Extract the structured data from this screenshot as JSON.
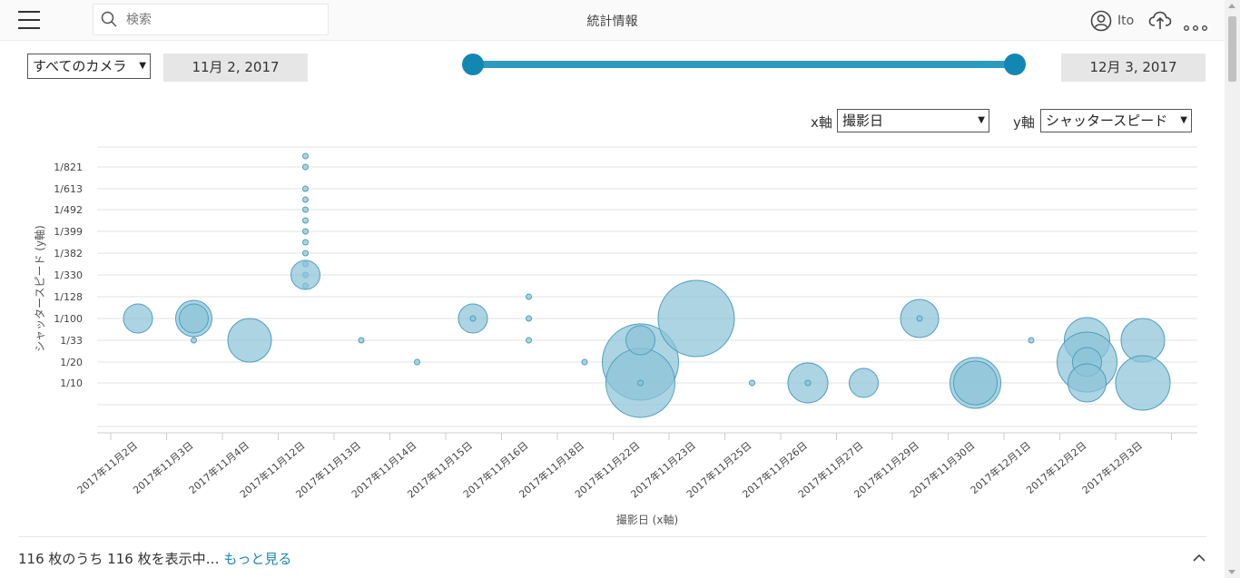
{
  "header": {
    "title": "統計情報",
    "search_placeholder": "検索",
    "user_name": "Ito"
  },
  "filters": {
    "camera": "すべてのカメラ",
    "start_date": "11月 2, 2017",
    "end_date": "12月 3, 2017",
    "x_axis_label": "x軸",
    "x_axis_value": "撮影日",
    "y_axis_label": "y軸",
    "y_axis_value": "シャッタースピード"
  },
  "footer": {
    "count_text": "116 枚のうち 116 枚を表示中… ",
    "more_link": "もっと見る"
  },
  "colors": {
    "accent": "#1287b3",
    "track": "#2d9bbd",
    "bubble_fill": "#8cc3d8",
    "bubble_stroke": "#4d9fbe"
  },
  "chart_data": {
    "type": "scatter",
    "xlabel": "撮影日 (x軸)",
    "ylabel": "シャッタースピード (y軸)",
    "categories": [
      "2017年11月2日",
      "2017年11月3日",
      "2017年11月4日",
      "2017年11月12日",
      "2017年11月13日",
      "2017年11月14日",
      "2017年11月15日",
      "2017年11月16日",
      "2017年11月18日",
      "2017年11月22日",
      "2017年11月23日",
      "2017年11月25日",
      "2017年11月26日",
      "2017年11月27日",
      "2017年11月29日",
      "2017年11月30日",
      "2017年12月1日",
      "2017年12月2日",
      "2017年12月3日"
    ],
    "y_ticks": [
      "1/10",
      "1/20",
      "1/33",
      "1/100",
      "1/128",
      "1/330",
      "1/382",
      "1/399",
      "1/492",
      "1/613",
      "1/821"
    ],
    "grid": true,
    "points": [
      {
        "x": "2017年11月2日",
        "y": "1/100",
        "size": 16
      },
      {
        "x": "2017年11月3日",
        "y": "1/100",
        "size": 20
      },
      {
        "x": "2017年11月3日",
        "y": "1/100",
        "size": 16
      },
      {
        "x": "2017年11月3日",
        "y": "1/33",
        "size": 3
      },
      {
        "x": "2017年11月4日",
        "y": "1/33",
        "size": 24
      },
      {
        "x": "2017年11月12日",
        "y": "1/330",
        "size": 3
      },
      {
        "x": "2017年11月12日",
        "y": "1/330",
        "size": 3
      },
      {
        "x": "2017年11月12日",
        "y": "1/330",
        "size": 3
      },
      {
        "x": "2017年11月12日",
        "y": "1/330",
        "size": 16
      },
      {
        "x": "2017年11月12日",
        "y": "1/382",
        "size": 3
      },
      {
        "x": "2017年11月12日",
        "y": "1/399",
        "size": 3
      },
      {
        "x": "2017年11月12日",
        "y": "1/399",
        "size": 3
      },
      {
        "x": "2017年11月12日",
        "y": "1/492",
        "size": 3
      },
      {
        "x": "2017年11月12日",
        "y": "1/492",
        "size": 3
      },
      {
        "x": "2017年11月12日",
        "y": "1/613",
        "size": 3
      },
      {
        "x": "2017年11月12日",
        "y": "1/613",
        "size": 3
      },
      {
        "x": "2017年11月12日",
        "y": "1/821",
        "size": 3
      },
      {
        "x": "2017年11月12日",
        "y": "1/821",
        "size": 3
      },
      {
        "x": "2017年11月13日",
        "y": "1/33",
        "size": 3
      },
      {
        "x": "2017年11月14日",
        "y": "1/20",
        "size": 3
      },
      {
        "x": "2017年11月15日",
        "y": "1/100",
        "size": 16
      },
      {
        "x": "2017年11月15日",
        "y": "1/100",
        "size": 3
      },
      {
        "x": "2017年11月16日",
        "y": "1/128",
        "size": 3
      },
      {
        "x": "2017年11月16日",
        "y": "1/100",
        "size": 3
      },
      {
        "x": "2017年11月16日",
        "y": "1/33",
        "size": 3
      },
      {
        "x": "2017年11月18日",
        "y": "1/20",
        "size": 3
      },
      {
        "x": "2017年11月22日",
        "y": "1/20",
        "size": 42
      },
      {
        "x": "2017年11月22日",
        "y": "1/10",
        "size": 38
      },
      {
        "x": "2017年11月22日",
        "y": "1/33",
        "size": 16
      },
      {
        "x": "2017年11月22日",
        "y": "1/10",
        "size": 3
      },
      {
        "x": "2017年11月23日",
        "y": "1/100",
        "size": 42
      },
      {
        "x": "2017年11月25日",
        "y": "1/10",
        "size": 3
      },
      {
        "x": "2017年11月26日",
        "y": "1/10",
        "size": 22
      },
      {
        "x": "2017年11月26日",
        "y": "1/10",
        "size": 3
      },
      {
        "x": "2017年11月27日",
        "y": "1/10",
        "size": 16
      },
      {
        "x": "2017年11月29日",
        "y": "1/100",
        "size": 21
      },
      {
        "x": "2017年11月29日",
        "y": "1/100",
        "size": 3
      },
      {
        "x": "2017年11月30日",
        "y": "1/10",
        "size": 28
      },
      {
        "x": "2017年11月30日",
        "y": "1/10",
        "size": 24
      },
      {
        "x": "2017年12月1日",
        "y": "1/33",
        "size": 3
      },
      {
        "x": "2017年12月2日",
        "y": "1/33",
        "size": 25
      },
      {
        "x": "2017年12月2日",
        "y": "1/20",
        "size": 33
      },
      {
        "x": "2017年12月2日",
        "y": "1/20",
        "size": 16
      },
      {
        "x": "2017年12月2日",
        "y": "1/10",
        "size": 21
      },
      {
        "x": "2017年12月3日",
        "y": "1/33",
        "size": 24
      },
      {
        "x": "2017年12月3日",
        "y": "1/10",
        "size": 30
      }
    ]
  }
}
